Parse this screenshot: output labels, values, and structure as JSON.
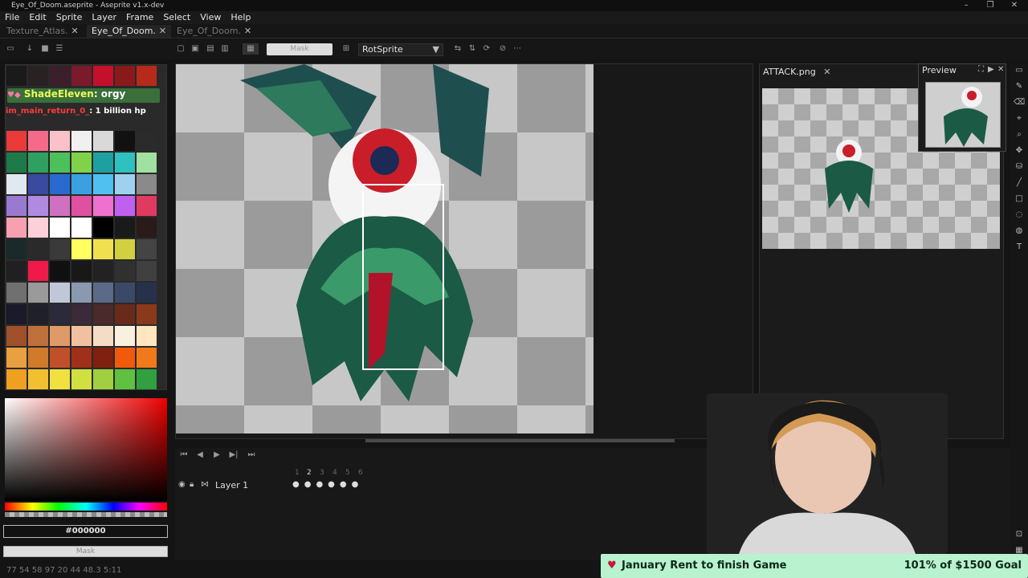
{
  "window": {
    "title": "Eye_Of_Doom.aseprite - Aseprite v1.x-dev",
    "minimize": "–",
    "restore": "❐",
    "close": "✕"
  },
  "menu": [
    "File",
    "Edit",
    "Sprite",
    "Layer",
    "Frame",
    "Select",
    "View",
    "Help"
  ],
  "tabs": [
    {
      "label": "Texture_Atlas.",
      "active": false
    },
    {
      "label": "Eye_Of_Doom.",
      "active": true
    },
    {
      "label": "Eye_Of_Doom.",
      "active": false
    }
  ],
  "tab_close": "✕",
  "toolbar": {
    "mask_label": "Mask",
    "rotation_algorithm": "RotSprite"
  },
  "chat": [
    {
      "user": "ShadeEleven",
      "message": ": orgy",
      "color": "#55e04c"
    },
    {
      "user": "im_main_return_0_",
      "message": ": 1 billion hp",
      "color": "#ff3b3b"
    }
  ],
  "color": {
    "hex": "#000000",
    "mask_label": "Mask"
  },
  "timeline": {
    "layer_name": "Layer 1",
    "frames": [
      "1",
      "2",
      "3",
      "4",
      "5",
      "6"
    ],
    "current_frame": "2"
  },
  "attack_panel": {
    "title": "ATTACK.png",
    "close": "✕"
  },
  "preview": {
    "title": "Preview"
  },
  "status": {
    "text": "77 54   58 97   20 44   48.3   5:11"
  },
  "goal": {
    "label": "January Rent to finish Game",
    "progress_text": "101% of $1500 Goal",
    "progress_fraction": 1.01
  }
}
